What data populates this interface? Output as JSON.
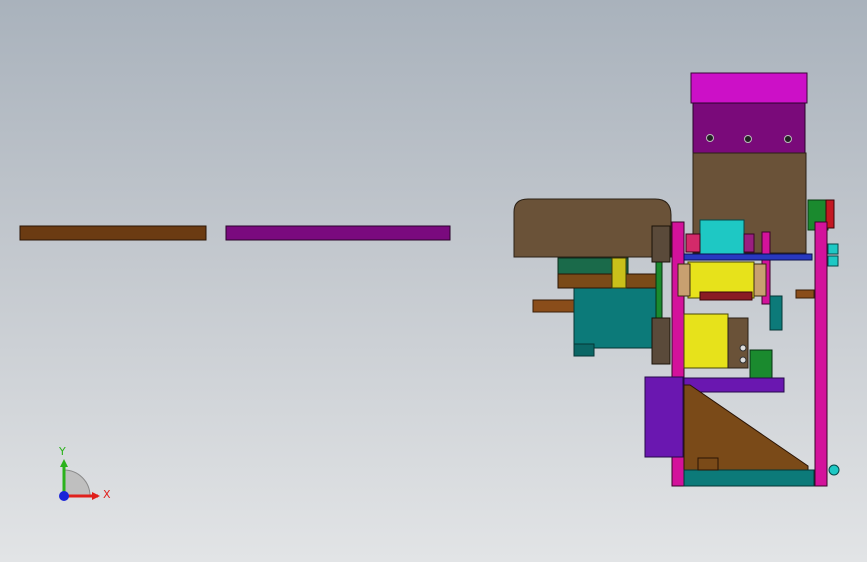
{
  "viewport": {
    "background_top": "#a9b2bc",
    "background_bottom": "#e2e4e6"
  },
  "model": {
    "part_colors": {
      "brown": "#6b3b12",
      "purple": "#7a0a7e",
      "magenta": "#d3129b",
      "hood_magenta": "#cc10c7",
      "dark_brown": "#6a5238",
      "teal": "#0c7a79",
      "cyan": "#1ec8c4",
      "yellow": "#e7e21b",
      "green": "#1a8a2e",
      "violet": "#6a17b0",
      "orange_brown": "#8a4d1a",
      "maroon": "#7a1024"
    }
  },
  "triad": {
    "x_label": "X",
    "y_label": "Y",
    "x_color": "#e0201c",
    "y_color": "#2bb21c",
    "z_color": "#1a24d8"
  }
}
